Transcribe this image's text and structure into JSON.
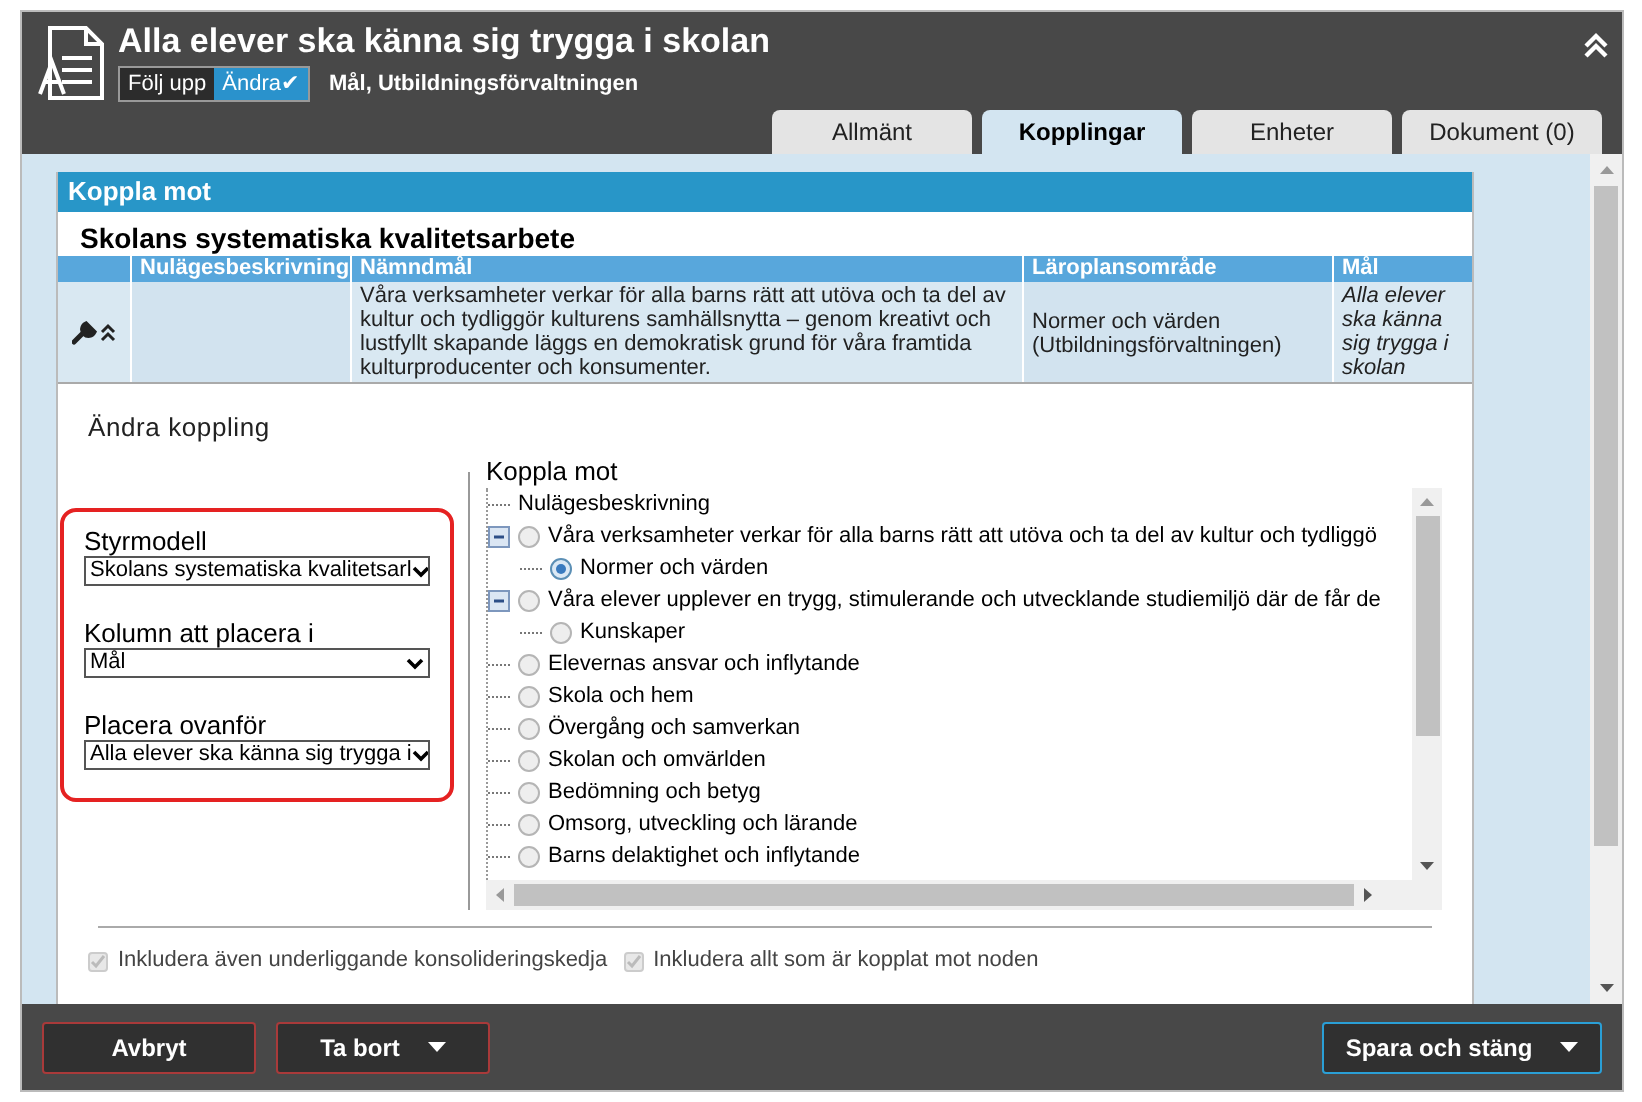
{
  "header": {
    "title": "Alla elever ska känna sig trygga i skolan",
    "badges": [
      {
        "label": "Följ upp",
        "selected": false
      },
      {
        "label": "Ändra✔",
        "selected": true
      }
    ],
    "subtitle": "Mål, Utbildningsförvaltningen"
  },
  "tabs": [
    {
      "label": "Allmänt",
      "selected": false
    },
    {
      "label": "Kopplingar",
      "selected": true
    },
    {
      "label": "Enheter",
      "selected": false
    },
    {
      "label": "Dokument (0)",
      "selected": false
    }
  ],
  "panel": {
    "title": "Koppla mot",
    "section_title": "Skolans systematiska kvalitetsarbete",
    "table": {
      "columns": [
        "Nulägesbeskrivning",
        "Nämndmål",
        "Läroplansområde",
        "Mål"
      ],
      "rows": [
        {
          "cells": [
            "",
            "Våra verksamheter verkar för alla barns rätt att utöva och ta del av kultur och tydliggör kulturens samhällsnytta – genom kreativt och lustfyllt skapande läggs en demokratisk grund för våra framtida kulturproducenter och konsumenter.",
            "Normer och värden (Utbildningsförvaltningen)",
            "Alla elever ska känna sig trygga i skolan"
          ]
        }
      ]
    }
  },
  "edit": {
    "title": "Ändra koppling",
    "fields": [
      {
        "label": "Styrmodell",
        "value": "Skolans systematiska kvalitetsarl"
      },
      {
        "label": "Kolumn att placera i",
        "value": "Mål"
      },
      {
        "label": "Placera ovanför",
        "value": "Alla elever ska känna sig trygga i"
      }
    ],
    "tree": {
      "title": "Koppla mot",
      "items": [
        {
          "kind": "label",
          "label": "Nulägesbeskrivning"
        },
        {
          "kind": "radio",
          "label": "Våra verksamheter verkar för alla barns rätt att utöva och ta del av kultur och tydliggö",
          "selected": false,
          "expanded": true,
          "children": [
            {
              "kind": "radio",
              "label": "Normer och värden",
              "selected": true
            }
          ]
        },
        {
          "kind": "radio",
          "label": "Våra elever upplever en trygg, stimulerande och utvecklande studiemiljö där de får de",
          "selected": false,
          "expanded": true,
          "children": [
            {
              "kind": "radio",
              "label": "Kunskaper",
              "selected": false
            }
          ]
        },
        {
          "kind": "radio",
          "label": "Elevernas ansvar och inflytande",
          "selected": false
        },
        {
          "kind": "radio",
          "label": "Skola och hem",
          "selected": false
        },
        {
          "kind": "radio",
          "label": "Övergång och samverkan",
          "selected": false
        },
        {
          "kind": "radio",
          "label": "Skolan och omvärlden",
          "selected": false
        },
        {
          "kind": "radio",
          "label": "Bedömning och betyg",
          "selected": false
        },
        {
          "kind": "radio",
          "label": "Omsorg, utveckling och lärande",
          "selected": false
        },
        {
          "kind": "radio",
          "label": "Barns delaktighet och inflytande",
          "selected": false
        }
      ]
    },
    "options": [
      {
        "label": "Inkludera även underliggande konsolideringskedja",
        "checked": true,
        "disabled": true
      },
      {
        "label": "Inkludera allt som är kopplat mot noden",
        "checked": true,
        "disabled": true
      }
    ]
  },
  "footer": {
    "buttons": [
      {
        "label": "Avbryt",
        "kind": "danger",
        "menu": false
      },
      {
        "label": "Ta bort",
        "kind": "danger",
        "menu": true
      },
      {
        "label": "Spara och stäng",
        "kind": "primary",
        "menu": true
      }
    ]
  }
}
